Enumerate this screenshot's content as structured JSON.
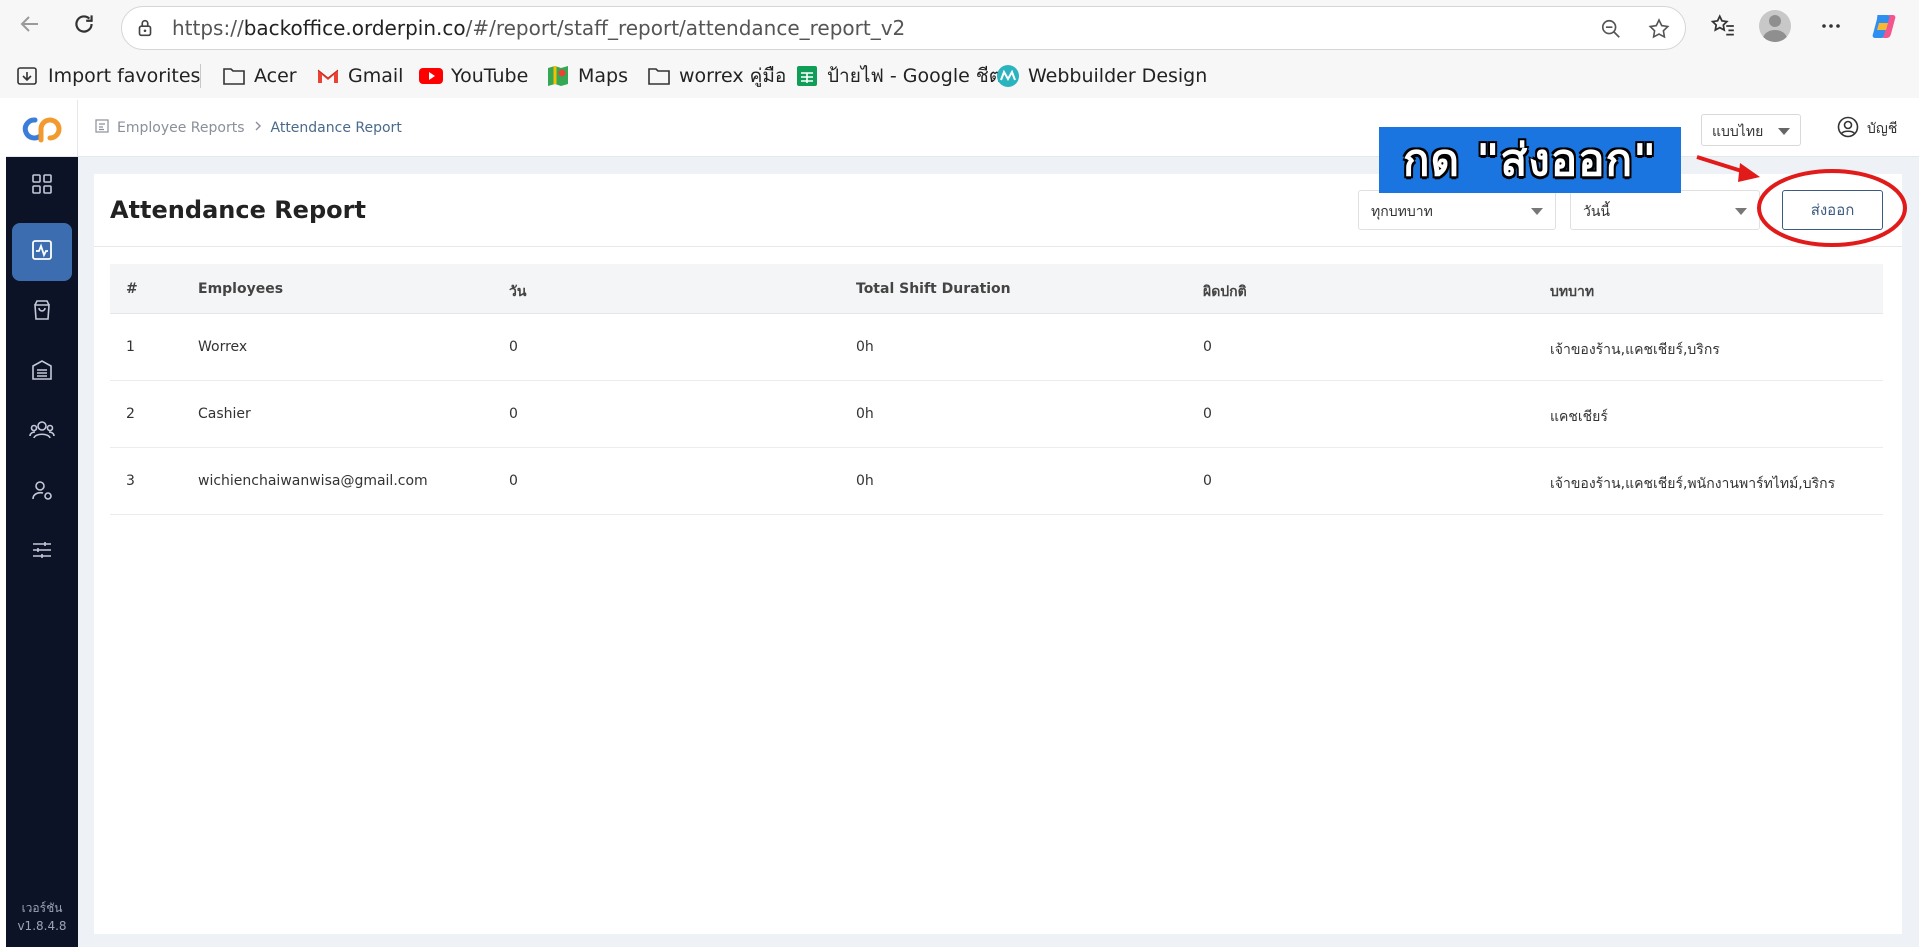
{
  "browser": {
    "url_prefix": "https://",
    "url_domain": "backoffice.orderpin.co",
    "url_path": "/#/report/staff_report/attendance_report_v2",
    "bookmarks": [
      {
        "label": "Import favorites",
        "icon": "import-icon"
      },
      {
        "label": "Acer",
        "icon": "folder-icon"
      },
      {
        "label": "Gmail",
        "icon": "gmail-icon"
      },
      {
        "label": "YouTube",
        "icon": "youtube-icon"
      },
      {
        "label": "Maps",
        "icon": "maps-icon"
      },
      {
        "label": "worrex คู่มือ",
        "icon": "folder-icon"
      },
      {
        "label": "ป้ายไฟ - Google ชีต",
        "icon": "sheets-icon"
      },
      {
        "label": "Webbuilder Design",
        "icon": "webbuilder-icon"
      }
    ]
  },
  "header": {
    "breadcrumb": {
      "parent": "Employee Reports",
      "current": "Attendance Report"
    },
    "language": "แบบไทย",
    "account": "บัญชี"
  },
  "sidebar": {
    "items": [
      {
        "icon": "dashboard-icon",
        "active": false
      },
      {
        "icon": "report-icon",
        "active": true
      },
      {
        "icon": "shopping-bag-icon",
        "active": false
      },
      {
        "icon": "inventory-icon",
        "active": false
      },
      {
        "icon": "users-icon",
        "active": false
      },
      {
        "icon": "user-settings-icon",
        "active": false
      },
      {
        "icon": "sliders-icon",
        "active": false
      }
    ],
    "version_label": "เวอร์ชัน",
    "version": "v1.8.4.8"
  },
  "main": {
    "title": "Attendance Report",
    "role_filter": "ทุกบทบาท",
    "date_filter": "วันนี้",
    "export_label": "ส่งออก",
    "table": {
      "headers": [
        "#",
        "Employees",
        "วัน",
        "Total Shift Duration",
        "ผิดปกติ",
        "บทบาท"
      ],
      "rows": [
        [
          "1",
          "Worrex",
          "0",
          "0h",
          "0",
          "เจ้าของร้าน,แคชเชียร์,บริกร"
        ],
        [
          "2",
          "Cashier",
          "0",
          "0h",
          "0",
          "แคชเชียร์"
        ],
        [
          "3",
          "wichienchaiwanwisa@gmail.com",
          "0",
          "0h",
          "0",
          "เจ้าของร้าน,แคชเชียร์,พนักงานพาร์ทไทม์,บริกร"
        ]
      ]
    }
  },
  "annotation": {
    "callout_text": "กด \"ส่งออก\"",
    "callout_color": "#1a75e0",
    "highlight_color": "#e11a1a"
  },
  "colors": {
    "sidebar_bg": "#0d1326",
    "sidebar_active": "#3c6db0",
    "accent": "#3d5a80"
  }
}
